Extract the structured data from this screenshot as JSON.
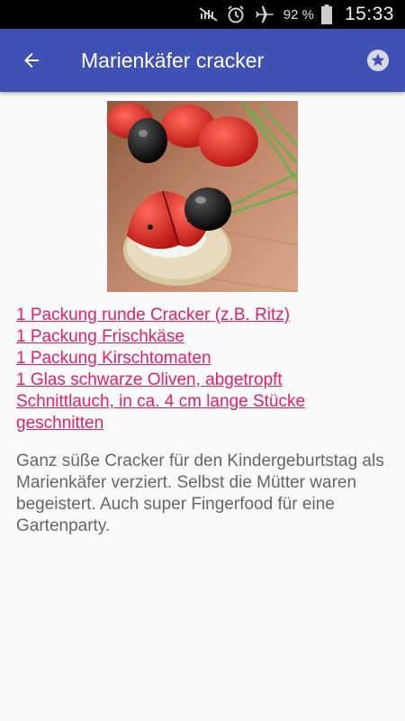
{
  "status_bar": {
    "battery_percent": "92 %",
    "time": "15:33",
    "icons": [
      "mute-icon",
      "alarm-icon",
      "airplane-icon",
      "battery-icon"
    ]
  },
  "app_bar": {
    "title": "Marienkäfer cracker",
    "back_icon": "arrow-left-icon",
    "favorite_icon": "star-icon",
    "color": "#3f51b5"
  },
  "recipe": {
    "ingredients": [
      "1 Packung runde Cracker (z.B. Ritz)",
      "1 Packung Frischkäse",
      "1 Packung Kirschtomaten",
      "1 Glas schwarze Oliven, abgetropft",
      "Schnittlauch, in ca. 4 cm lange Stücke geschnitten"
    ],
    "link_color": "#e91e63",
    "description": "Ganz süße Cracker für den Kindergeburtstag als Marienkäfer verziert. Selbst die Mütter waren begeistert. Auch super Fingerfood für eine Gartenparty."
  }
}
